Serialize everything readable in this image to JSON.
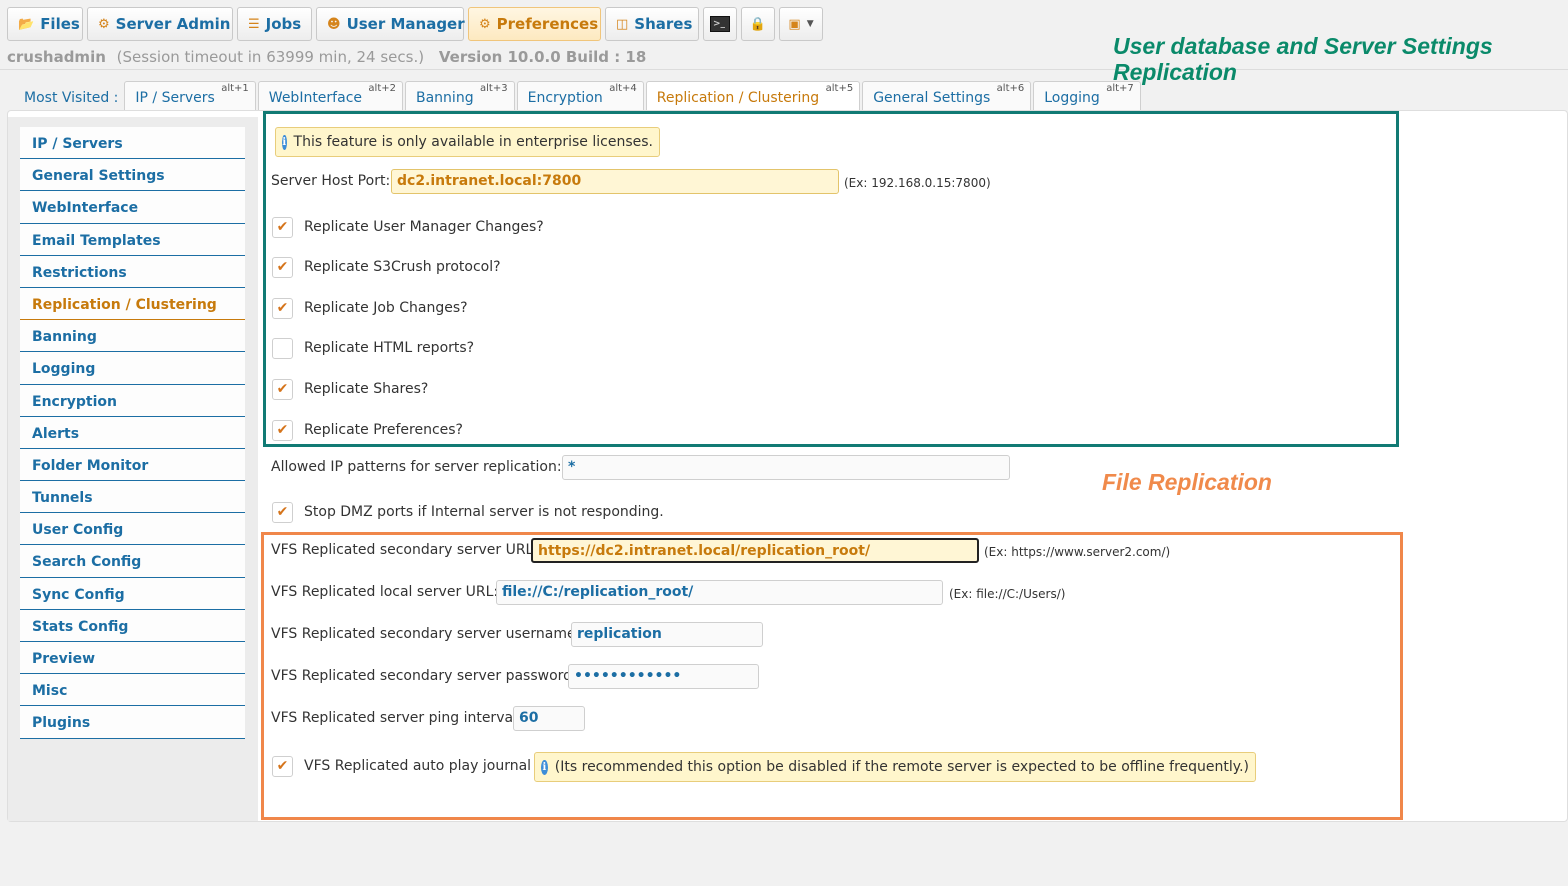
{
  "topbar": {
    "buttons": [
      {
        "label": "Files",
        "icon": "folder-icon"
      },
      {
        "label": "Server Admin",
        "icon": "gear-icon"
      },
      {
        "label": "Jobs",
        "icon": "jobs-icon"
      },
      {
        "label": "User Manager",
        "icon": "user-icon"
      },
      {
        "label": "Preferences",
        "icon": "preferences-icon"
      },
      {
        "label": "Shares",
        "icon": "shares-icon"
      }
    ]
  },
  "session": {
    "user": "crushadmin",
    "timeout": "(Session timeout in 63999 min, 24 secs.)",
    "version": "Version 10.0.0 Build : 18"
  },
  "annotations": {
    "green": "User database and Server Settings Replication",
    "orange": "File Replication"
  },
  "tabs": {
    "most_visited": "Most Visited :",
    "items": [
      {
        "label": "IP / Servers",
        "key": "alt+1"
      },
      {
        "label": "WebInterface",
        "key": "alt+2"
      },
      {
        "label": "Banning",
        "key": "alt+3"
      },
      {
        "label": "Encryption",
        "key": "alt+4"
      },
      {
        "label": "Replication / Clustering",
        "key": "alt+5"
      },
      {
        "label": "General Settings",
        "key": "alt+6"
      },
      {
        "label": "Logging",
        "key": "alt+7"
      }
    ]
  },
  "sidebar": {
    "items": [
      "IP / Servers",
      "General Settings",
      "WebInterface",
      "Email Templates",
      "Restrictions",
      "Replication / Clustering",
      "Banning",
      "Logging",
      "Encryption",
      "Alerts",
      "Folder Monitor",
      "Tunnels",
      "User Config",
      "Search Config",
      "Sync Config",
      "Stats Config",
      "Preview",
      "Misc",
      "Plugins"
    ]
  },
  "form": {
    "enterprise_notice": "This feature is only available in enterprise licenses.",
    "host_port_label": "Server Host Port:",
    "host_port_value": "dc2.intranet.local:7800",
    "host_port_hint": "(Ex: 192.168.0.15:7800)",
    "checks": [
      {
        "label": "Replicate User Manager Changes?",
        "checked": true
      },
      {
        "label": "Replicate S3Crush protocol?",
        "checked": true
      },
      {
        "label": "Replicate Job Changes?",
        "checked": true
      },
      {
        "label": "Replicate HTML reports?",
        "checked": false
      },
      {
        "label": "Replicate Shares?",
        "checked": true
      },
      {
        "label": "Replicate Preferences?",
        "checked": true
      }
    ],
    "allowed_ip_label": "Allowed IP patterns for server replication:",
    "allowed_ip_value": "*",
    "stop_dmz_label": "Stop DMZ ports if Internal server is not responding.",
    "vfs_secondary_url_label": "VFS Replicated secondary server URL:",
    "vfs_secondary_url_value": "https://dc2.intranet.local/replication_root/",
    "vfs_secondary_url_hint": "(Ex: https://www.server2.com/)",
    "vfs_local_url_label": "VFS Replicated local server URL:",
    "vfs_local_url_value": "file://C:/replication_root/",
    "vfs_local_url_hint": "(Ex: file://C:/Users/)",
    "vfs_username_label": "VFS Replicated secondary server username:",
    "vfs_username_value": "replication",
    "vfs_password_label": "VFS Replicated secondary server password:",
    "vfs_password_value": "••••••••••••",
    "vfs_ping_label": "VFS Replicated server ping interval",
    "vfs_ping_value": "60",
    "vfs_autoplay_label": "VFS Replicated auto play journal",
    "vfs_autoplay_notice": "(Its recommended this option be disabled if the remote server is expected to be offline frequently.)"
  },
  "colors": {
    "link": "#1c6ea4",
    "active": "#c77a0c",
    "green_frame": "#117a74",
    "orange_frame": "#f0874a"
  }
}
